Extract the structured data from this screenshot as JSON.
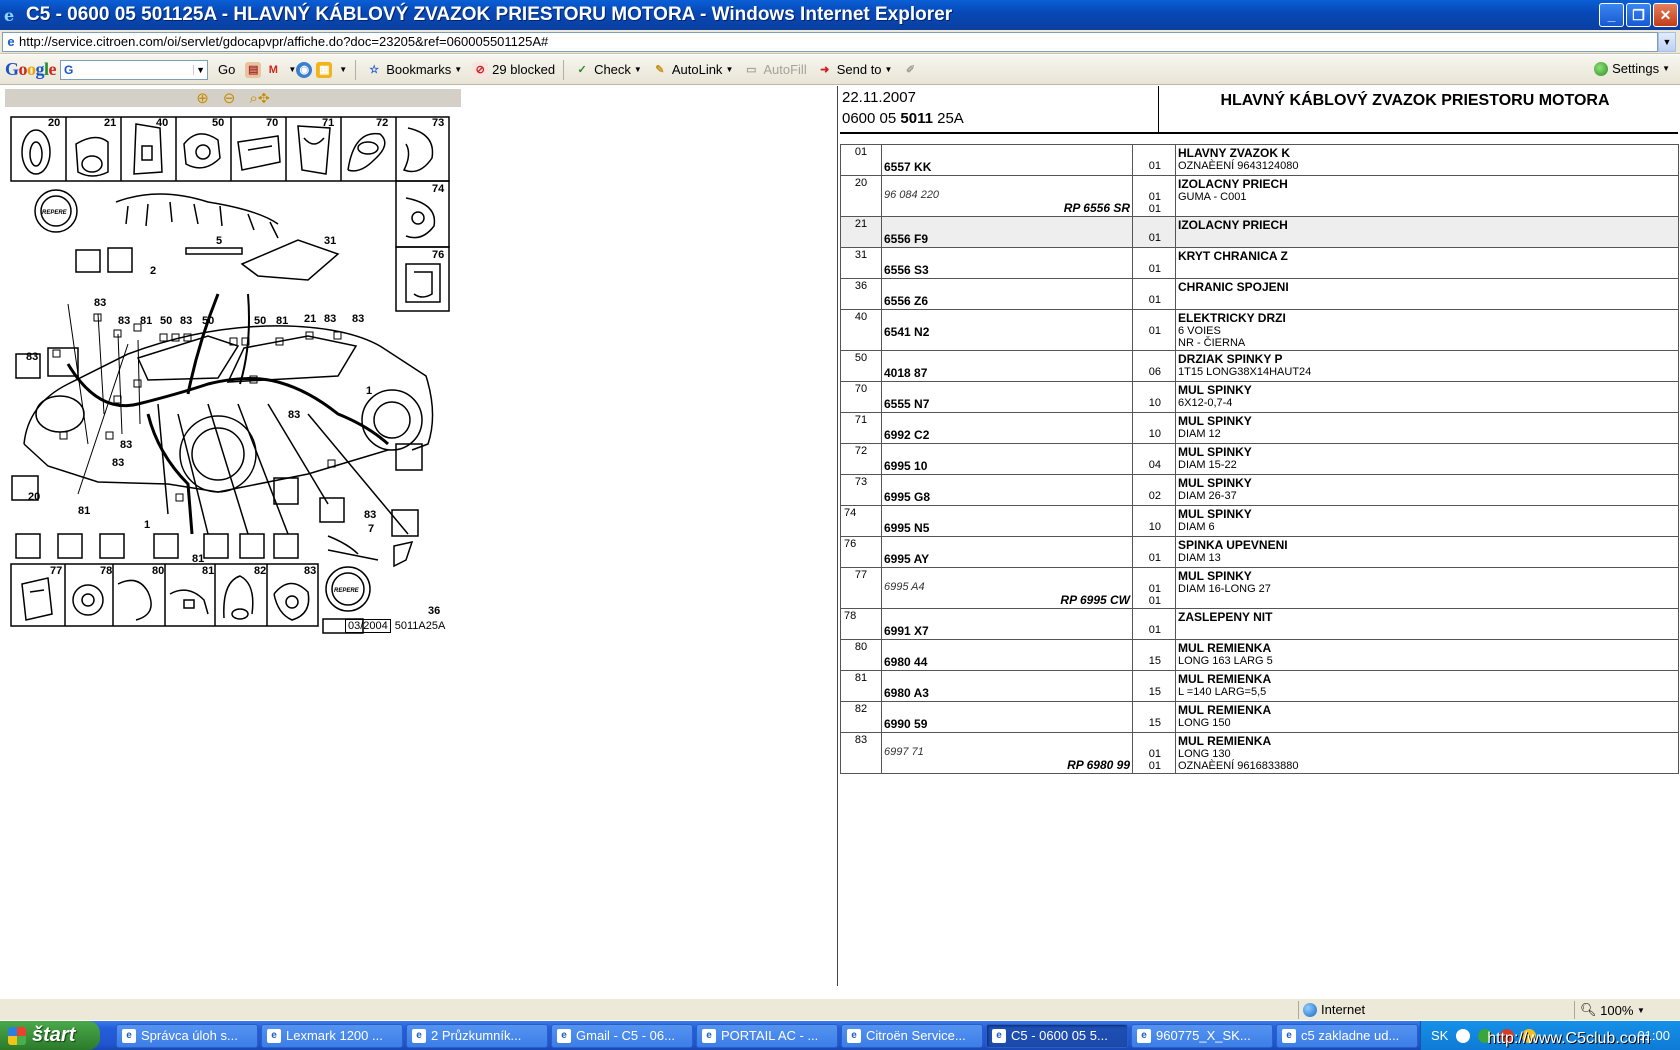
{
  "window": {
    "title": "C5 - 0600 05 501125A - HLAVNÝ KÁBLOVÝ ZVAZOK PRIESTORU MOTORA - Windows Internet Explorer",
    "minimize": "_",
    "maximize": "❐",
    "close": "✕"
  },
  "address": {
    "url": "http://service.citroen.com/oi/servlet/gdocapvpr/affiche.do?doc=23205&ref=060005501125A#"
  },
  "google_toolbar": {
    "logo_letters": [
      "G",
      "o",
      "o",
      "g",
      "l",
      "e"
    ],
    "search_prefix": "G",
    "go_label": "Go",
    "bookmarks_label": "Bookmarks",
    "blocked_label": "29 blocked",
    "check_label": "Check",
    "autolink_label": "AutoLink",
    "autofill_label": "AutoFill",
    "sendto_label": "Send to",
    "settings_label": "Settings"
  },
  "zoom_tools": [
    "zoom-in-icon",
    "zoom-out-icon",
    "zoom-pan-icon"
  ],
  "diagram": {
    "callouts": [
      "20",
      "21",
      "40",
      "50",
      "70",
      "71",
      "72",
      "73",
      "74",
      "76",
      "77",
      "78",
      "80",
      "81",
      "82",
      "83",
      "1",
      "2",
      "5",
      "7",
      "31",
      "36"
    ],
    "stamp_label": "REPERE",
    "date": "03/2004",
    "code": "5011A25A"
  },
  "doc_header": {
    "date": "22.11.2007",
    "ref_prefix": "0600 05",
    "ref_bold": "5011",
    "ref_suffix": "25A",
    "title": "HLAVNÝ KÁBLOVÝ ZVAZOK PRIESTORU MOTORA"
  },
  "parts": [
    {
      "pos": "01",
      "ref": "",
      "code": "6557 KK",
      "rp": "",
      "qty": [
        "01"
      ],
      "title": "HLAVNY ZVAZOK K",
      "lines": [
        " OZNAÈENÍ 9643124080"
      ],
      "highlight": false,
      "pos_left": false
    },
    {
      "pos": "20",
      "ref": "96 084 220",
      "code": "",
      "rp": "RP 6556 SR",
      "qty": [
        "01",
        "01"
      ],
      "title": "IZOLACNY PRIECH",
      "lines": [
        "GUMA - C001"
      ],
      "highlight": false,
      "pos_left": false
    },
    {
      "pos": "21",
      "ref": "",
      "code": "6556 F9",
      "rp": "",
      "qty": [
        "01"
      ],
      "title": "IZOLACNY PRIECH",
      "lines": [],
      "highlight": true,
      "pos_left": false
    },
    {
      "pos": "31",
      "ref": "",
      "code": "6556 S3",
      "rp": "",
      "qty": [
        "01"
      ],
      "title": "KRYT CHRANICA Z",
      "lines": [],
      "highlight": false,
      "pos_left": false
    },
    {
      "pos": "36",
      "ref": "",
      "code": "6556 Z6",
      "rp": "",
      "qty": [
        "01"
      ],
      "title": "CHRANIC SPOJENI",
      "lines": [],
      "highlight": false,
      "pos_left": false
    },
    {
      "pos": "40",
      "ref": "",
      "code": "6541 N2",
      "rp": "",
      "qty": [
        "01"
      ],
      "title": "ELEKTRICKY DRZI",
      "lines": [
        "6 VOIES",
        "NR - ČIERNA"
      ],
      "highlight": false,
      "pos_left": false
    },
    {
      "pos": "50",
      "ref": "",
      "code": "4018 87",
      "rp": "",
      "qty": [
        "06"
      ],
      "title": "DRZIAK SPINKY P",
      "lines": [
        "1T15 LONG38X14HAUT24"
      ],
      "highlight": false,
      "pos_left": false
    },
    {
      "pos": "70",
      "ref": "",
      "code": "6555 N7",
      "rp": "",
      "qty": [
        "10"
      ],
      "title": "MUL SPINKY",
      "lines": [
        "6X12-0,7-4"
      ],
      "highlight": false,
      "pos_left": false
    },
    {
      "pos": "71",
      "ref": "",
      "code": "6992 C2",
      "rp": "",
      "qty": [
        "10"
      ],
      "title": "MUL SPINKY",
      "lines": [
        "DIAM 12"
      ],
      "highlight": false,
      "pos_left": false
    },
    {
      "pos": "72",
      "ref": "",
      "code": "6995 10",
      "rp": "",
      "qty": [
        "04"
      ],
      "title": "MUL SPINKY",
      "lines": [
        "DIAM 15-22"
      ],
      "highlight": false,
      "pos_left": false
    },
    {
      "pos": "73",
      "ref": "",
      "code": "6995 G8",
      "rp": "",
      "qty": [
        "02"
      ],
      "title": "MUL SPINKY",
      "lines": [
        "DIAM 26-37"
      ],
      "highlight": false,
      "pos_left": false
    },
    {
      "pos": "74",
      "ref": "",
      "code": "6995 N5",
      "rp": "",
      "qty": [
        "10"
      ],
      "title": "MUL SPINKY",
      "lines": [
        "DIAM 6"
      ],
      "highlight": false,
      "pos_left": true
    },
    {
      "pos": "76",
      "ref": "",
      "code": "6995 AY",
      "rp": "",
      "qty": [
        "01"
      ],
      "title": "SPINKA UPEVNENI",
      "lines": [
        "DIAM 13"
      ],
      "highlight": false,
      "pos_left": true
    },
    {
      "pos": "77",
      "ref": "6995 A4",
      "code": "",
      "rp": "RP 6995 CW",
      "qty": [
        "01",
        "01"
      ],
      "title": "MUL SPINKY",
      "lines": [
        "DIAM 16-LONG 27"
      ],
      "highlight": false,
      "pos_left": false
    },
    {
      "pos": "78",
      "ref": "",
      "code": "6991 X7",
      "rp": "",
      "qty": [
        "01"
      ],
      "title": "ZASLEPENY NIT",
      "lines": [],
      "highlight": false,
      "pos_left": true
    },
    {
      "pos": "80",
      "ref": "",
      "code": "6980 44",
      "rp": "",
      "qty": [
        "15"
      ],
      "title": "MUL REMIENKA",
      "lines": [
        "LONG 163 LARG 5"
      ],
      "highlight": false,
      "pos_left": false
    },
    {
      "pos": "81",
      "ref": "",
      "code": "6980 A3",
      "rp": "",
      "qty": [
        "15"
      ],
      "title": "MUL REMIENKA",
      "lines": [
        "L =140 LARG=5,5"
      ],
      "highlight": false,
      "pos_left": false
    },
    {
      "pos": "82",
      "ref": "",
      "code": "6990 59",
      "rp": "",
      "qty": [
        "15"
      ],
      "title": "MUL REMIENKA",
      "lines": [
        "LONG 150"
      ],
      "highlight": false,
      "pos_left": false
    },
    {
      "pos": "83",
      "ref": "6997 71",
      "code": "",
      "rp": "RP 6980 99",
      "qty": [
        "01",
        "01"
      ],
      "title": "MUL REMIENKA",
      "lines": [
        "LONG 130",
        " OZNAÈENÍ 9616833880"
      ],
      "highlight": false,
      "pos_left": false
    }
  ],
  "statusbar": {
    "zone": "Internet",
    "zoom": "100%"
  },
  "taskbar": {
    "start": "štart",
    "tasks": [
      {
        "label": "Správca úloh s...",
        "active": false
      },
      {
        "label": "Lexmark 1200 ...",
        "active": false
      },
      {
        "label": "2 Průzkumník...",
        "active": false
      },
      {
        "label": "Gmail - C5 - 06...",
        "active": false
      },
      {
        "label": "PORTAIL AC - ...",
        "active": false
      },
      {
        "label": "Citroën Service...",
        "active": false
      },
      {
        "label": "C5 - 0600 05 5...",
        "active": true
      },
      {
        "label": "960775_X_SK...",
        "active": false
      },
      {
        "label": "c5 zakladne ud...",
        "active": false
      }
    ],
    "lang": "SK",
    "clock": "01:00",
    "watermark": "http://www.C5club.com"
  }
}
